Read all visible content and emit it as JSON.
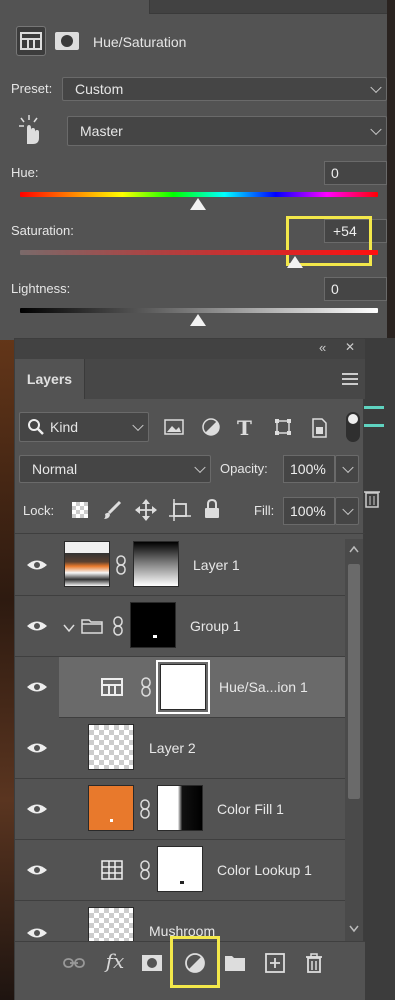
{
  "properties": {
    "title": "Hue/Saturation",
    "preset_label": "Preset:",
    "preset_value": "Custom",
    "channel_value": "Master",
    "hue_label": "Hue:",
    "hue_value": "0",
    "saturation_label": "Saturation:",
    "saturation_value": "+54",
    "lightness_label": "Lightness:",
    "lightness_value": "0"
  },
  "layers_panel": {
    "tab_label": "Layers",
    "collapse_glyph": "«",
    "close_glyph": "✕",
    "filter_kind": "Kind",
    "blend_mode": "Normal",
    "opacity_label": "Opacity:",
    "opacity_value": "100%",
    "lock_label": "Lock:",
    "fill_label": "Fill:",
    "fill_value": "100%",
    "layers": [
      {
        "name": "Layer 1"
      },
      {
        "name": "Group 1"
      },
      {
        "name": "Hue/Sa...ion 1"
      },
      {
        "name": "Layer 2"
      },
      {
        "name": "Color Fill 1"
      },
      {
        "name": "Color Lookup 1"
      },
      {
        "name": "Mushroom"
      }
    ],
    "fx_label": "fx"
  },
  "colors": {
    "panel": "#535353",
    "highlight": "#f3e84a",
    "fill_orange": "#e8792c",
    "selected_row": "#6a6a6a"
  }
}
